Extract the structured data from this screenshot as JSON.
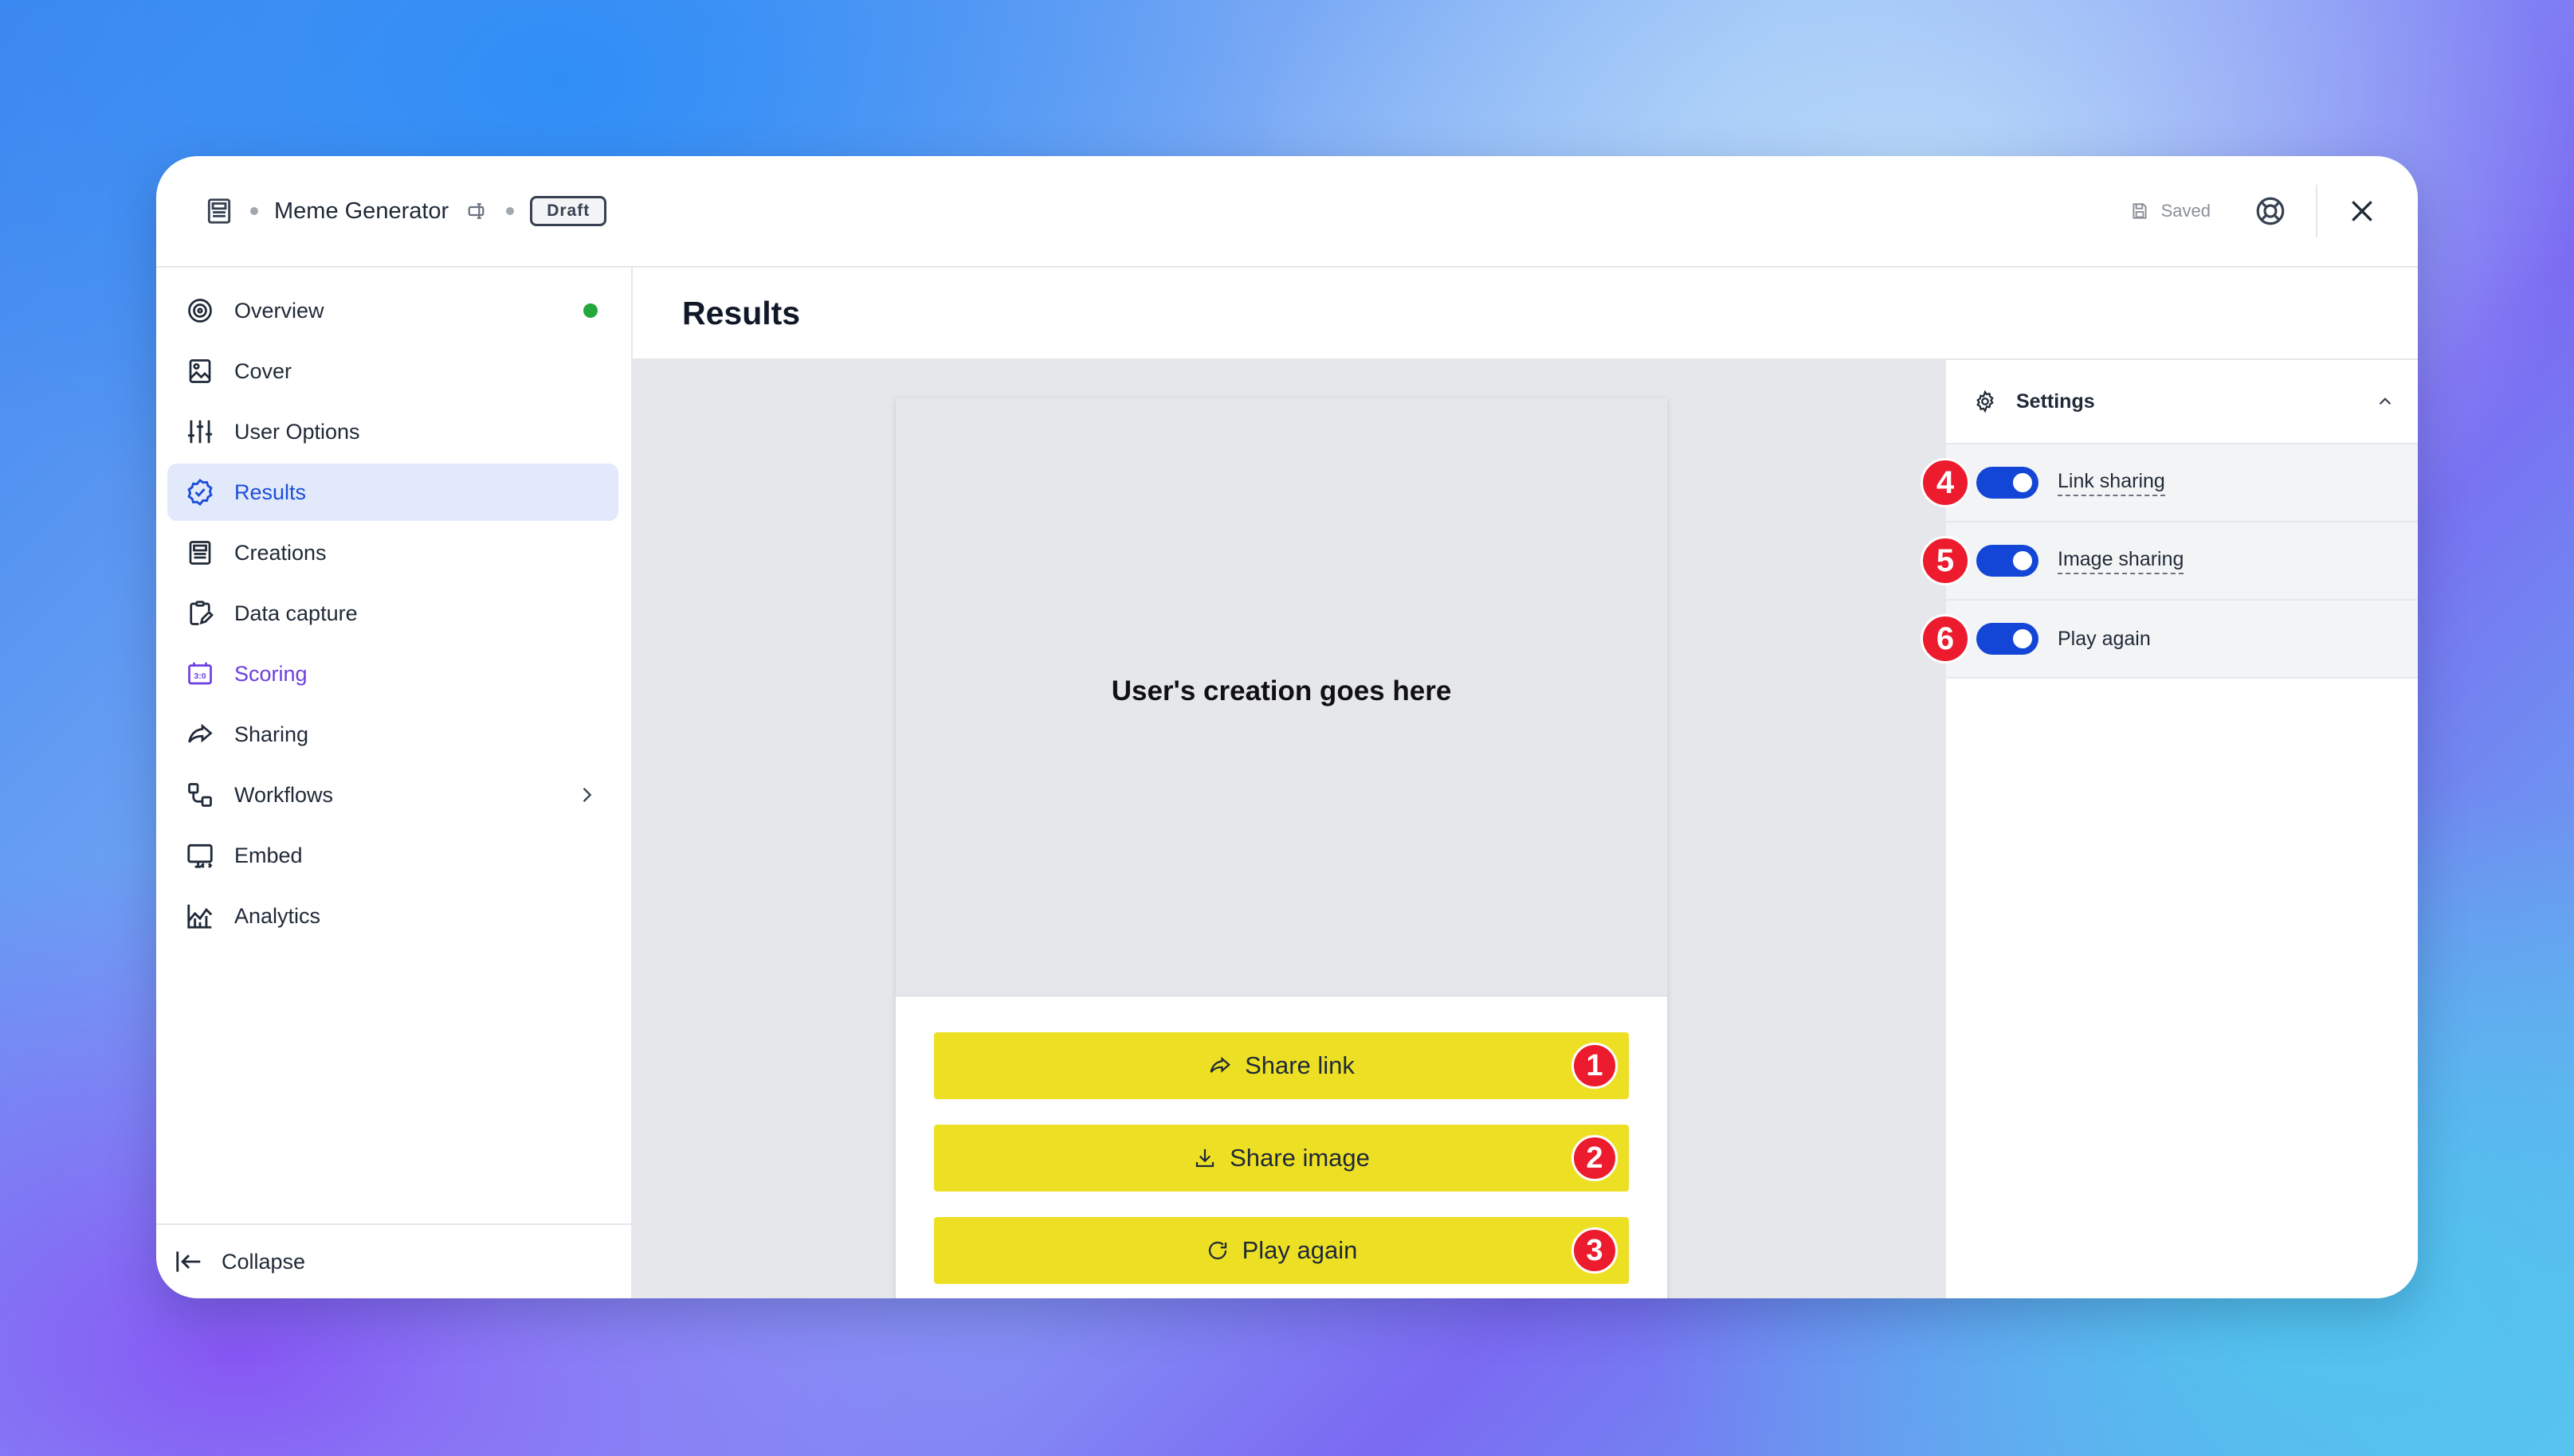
{
  "header": {
    "app_title": "Meme Generator",
    "status_badge": "Draft",
    "saved_label": "Saved"
  },
  "sidebar": {
    "items": [
      {
        "label": "Overview",
        "icon": "target-icon",
        "status": "green"
      },
      {
        "label": "Cover",
        "icon": "image-icon"
      },
      {
        "label": "User Options",
        "icon": "sliders-icon"
      },
      {
        "label": "Results",
        "icon": "check-badge-icon",
        "active": true
      },
      {
        "label": "Creations",
        "icon": "newspaper-icon"
      },
      {
        "label": "Data capture",
        "icon": "clipboard-edit-icon"
      },
      {
        "label": "Scoring",
        "icon": "scoreboard-icon"
      },
      {
        "label": "Sharing",
        "icon": "share-arrow-icon"
      },
      {
        "label": "Workflows",
        "icon": "workflow-icon"
      },
      {
        "label": "Embed",
        "icon": "monitor-code-icon"
      },
      {
        "label": "Analytics",
        "icon": "chart-icon"
      }
    ],
    "collapse_label": "Collapse"
  },
  "main": {
    "page_title": "Results",
    "preview": {
      "creation_placeholder": "User's creation goes here",
      "buttons": [
        {
          "label": "Share link",
          "icon": "share-arrow-icon",
          "badge": "1"
        },
        {
          "label": "Share image",
          "icon": "download-icon",
          "badge": "2"
        },
        {
          "label": "Play again",
          "icon": "refresh-icon",
          "badge": "3"
        }
      ]
    }
  },
  "settings": {
    "title": "Settings",
    "rows": [
      {
        "label": "Link sharing",
        "enabled": true,
        "badge": "4"
      },
      {
        "label": "Image sharing",
        "enabled": true,
        "badge": "5"
      },
      {
        "label": "Play again",
        "enabled": true,
        "badge": "6"
      }
    ]
  },
  "colors": {
    "accent_blue": "#1346d6",
    "button_yellow": "#ede024",
    "badge_red": "#ec1b2e",
    "active_bg": "#e1e9fb",
    "scoring_purple": "#6d3fe0",
    "status_green": "#22a83c"
  }
}
